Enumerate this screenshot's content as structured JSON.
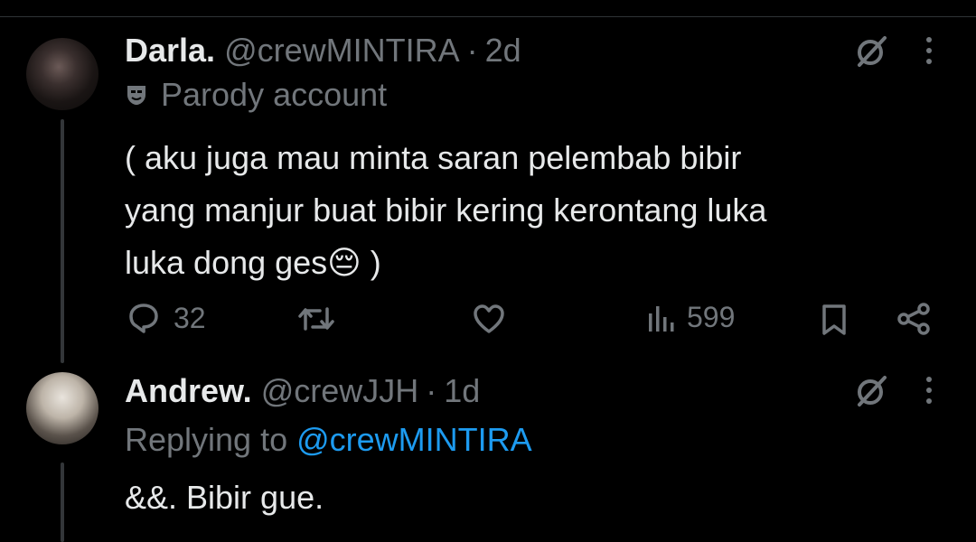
{
  "tweet": {
    "display_name": "Darla.",
    "handle": "@crewMINTIRA",
    "time": "2d",
    "parody_label": "Parody account",
    "text_lines": [
      "( aku juga mau minta saran pelembab bibir",
      "yang manjur buat bibir kering kerontang luka",
      "luka dong ges😔 )"
    ],
    "actions": {
      "reply_count": "32",
      "views_count": "599"
    }
  },
  "reply": {
    "display_name": "Andrew.",
    "handle": "@crewJJH",
    "time": "1d",
    "replying_prefix": "Replying to",
    "replying_mention": "@crewMINTIRA",
    "text": "&&. Bibir gue."
  },
  "separator": "·",
  "colors": {
    "background": "#000000",
    "primary_text": "#e7e9ea",
    "secondary_text": "#71767b",
    "link": "#1d9bf0",
    "divider": "#2f3336"
  },
  "icons": [
    "grok-icon",
    "more-icon",
    "mask-icon",
    "reply-icon",
    "retweet-icon",
    "like-icon",
    "views-icon",
    "bookmark-icon",
    "share-icon"
  ]
}
